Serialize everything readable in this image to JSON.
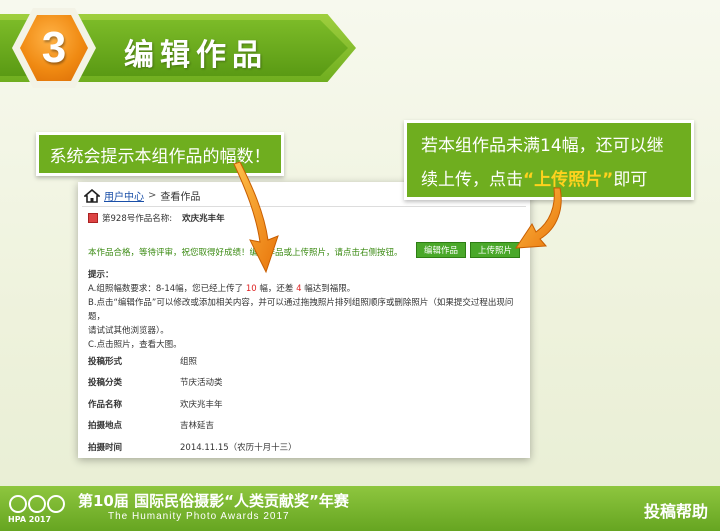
{
  "header": {
    "step_number": "3",
    "title": "编辑作品"
  },
  "callouts": {
    "left": "系统会提示本组作品的幅数！",
    "right_line1": "若本组作品未满14幅，还可以继",
    "right_line2_prefix": "续上传，点击",
    "right_line2_highlight": "“上传照片”",
    "right_line2_suffix": "即可"
  },
  "panel": {
    "breadcrumb": {
      "link": "用户中心",
      "separator": ">",
      "current": "查看作品"
    },
    "work_number_label": "第928号作品名称:",
    "work_name": "欢庆兆丰年",
    "status_text": "本作品合格，等待评审，祝您取得好成绩！编辑作品或上传照片，请点击右侧按钮。",
    "buttons": {
      "edit": "编辑作品",
      "upload": "上传照片"
    },
    "tips": {
      "title": "提示：",
      "a_prefix": "A.组照幅数要求：8-14幅，您已经上传了",
      "a_uploaded": "10",
      "a_mid": "幅，还差",
      "a_remaining": "4",
      "a_suffix": "幅达到福限。",
      "b_line1": "B.点击“编辑作品”可以修改或添加相关内容，并可以通过拖拽照片排列组照顺序或删除照片（如果提交过程出现问题，",
      "b_line2": "请试试其他浏览器）。",
      "c": "C.点击照片，查看大图。"
    },
    "details": [
      {
        "label": "投稿形式",
        "value": "组照"
      },
      {
        "label": "投稿分类",
        "value": "节庆活动类"
      },
      {
        "label": "作品名称",
        "value": "欢庆兆丰年"
      },
      {
        "label": "拍摄地点",
        "value": "吉林延吉"
      },
      {
        "label": "拍摄时间",
        "value": "2014.11.15（农历十月十三）"
      }
    ]
  },
  "footer": {
    "logo_text": "HPA 2017",
    "title_cn": "第10届 国际民俗摄影“人类贡献奖”年赛",
    "title_en": "The Humanity Photo Awards 2017",
    "help": "投稿帮助"
  },
  "colors": {
    "brand_green": "#6fae1f",
    "accent_orange": "#f08a12",
    "highlight_yellow": "#ffd21e",
    "button_green": "#4aa82a"
  },
  "icons": [
    "home-icon",
    "work-icon",
    "arrow-left-icon",
    "arrow-right-icon",
    "hpa-logo-icon"
  ]
}
